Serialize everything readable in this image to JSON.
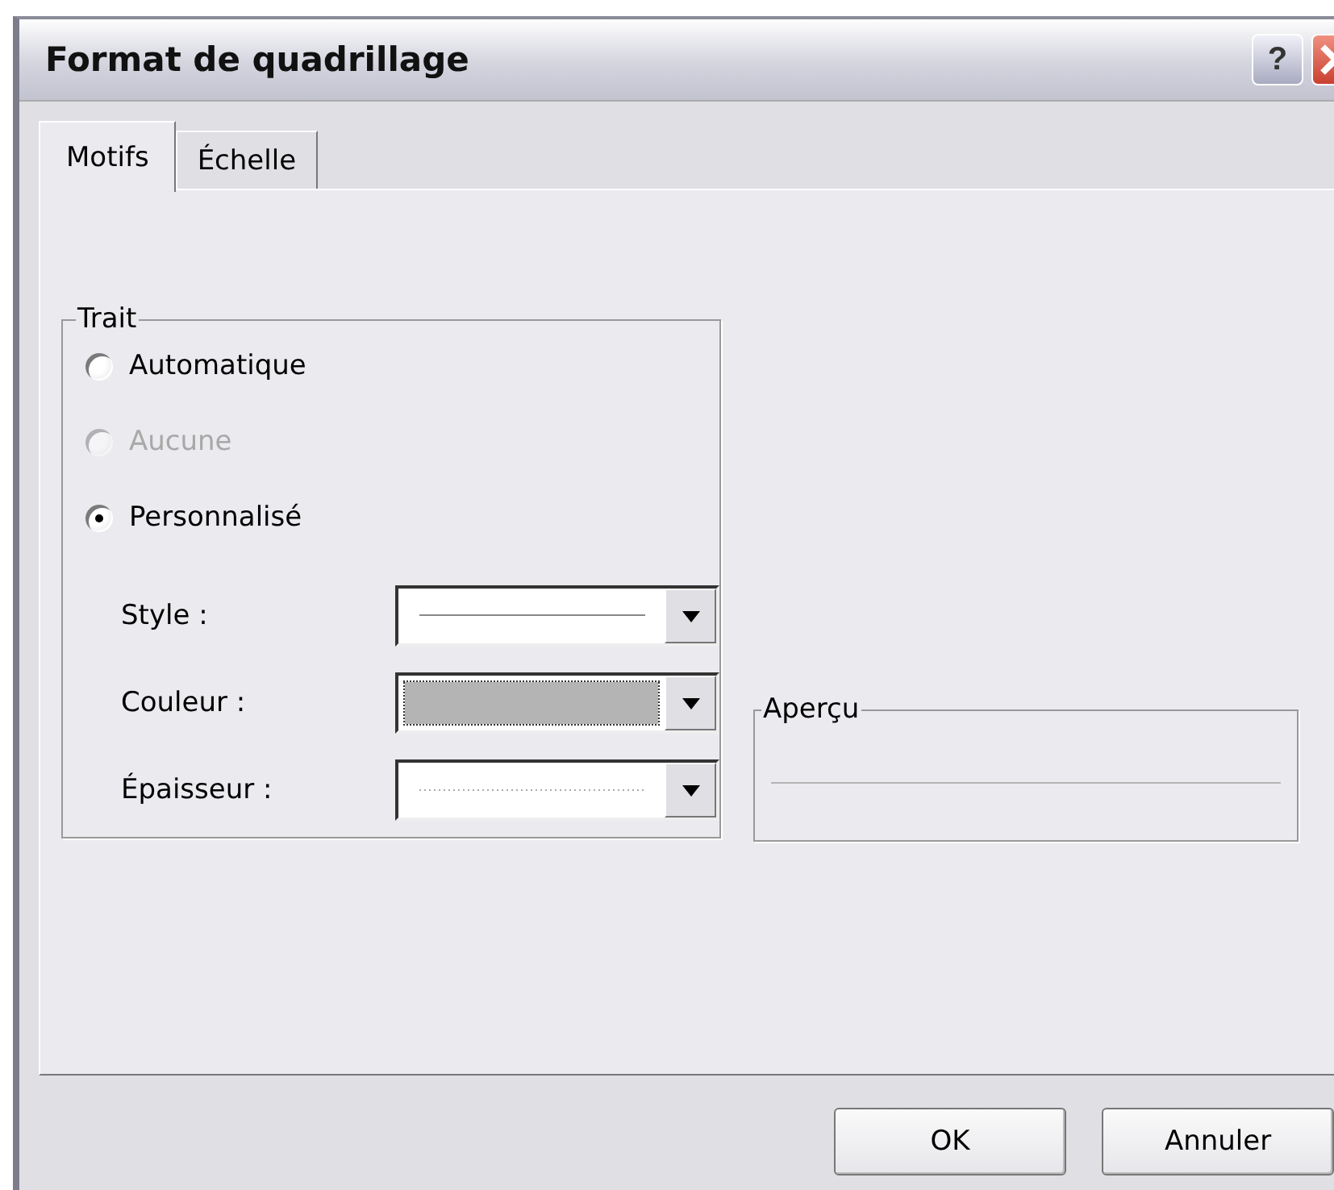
{
  "window": {
    "title": "Format de quadrillage"
  },
  "title_buttons": [
    {
      "kind": "help",
      "label": "?"
    },
    {
      "kind": "close"
    }
  ],
  "tabs": [
    {
      "label": "Motifs",
      "selected": true
    },
    {
      "label": "Échelle",
      "selected": false
    }
  ],
  "line_group": {
    "title": "Trait",
    "options": [
      {
        "label": "Automatique",
        "selected": false,
        "disabled": false
      },
      {
        "label": "Aucune",
        "selected": false,
        "disabled": true
      },
      {
        "label": "Personnalisé",
        "selected": true,
        "disabled": false
      }
    ],
    "fields": [
      {
        "label": "Style :",
        "kind": "line"
      },
      {
        "label": "Couleur :",
        "kind": "swatch",
        "color": "#b4b4b4",
        "focused": true
      },
      {
        "label": "Épaisseur :",
        "kind": "dotted"
      }
    ]
  },
  "preview_group": {
    "title": "Aperçu"
  },
  "buttons": [
    {
      "label": "OK"
    },
    {
      "label": "Annuler"
    }
  ]
}
